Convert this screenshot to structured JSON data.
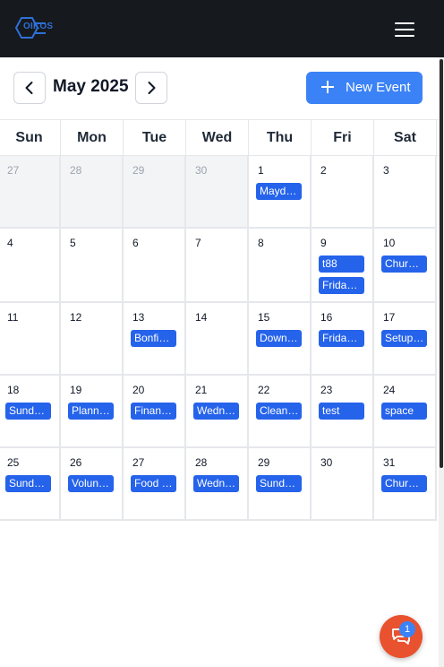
{
  "header": {
    "logo_text": "OIKOS",
    "logo_icon": "oikos-logo",
    "menu_icon": "hamburger-menu-icon"
  },
  "toolbar": {
    "month_title": "May 2025",
    "prev_icon": "chevron-left-icon",
    "next_icon": "chevron-right-icon",
    "new_event_label": "New Event"
  },
  "calendar": {
    "weekdays": [
      "Sun",
      "Mon",
      "Tue",
      "Wed",
      "Thu",
      "Fri",
      "Sat"
    ],
    "weeks": [
      [
        {
          "day": "27",
          "other": true,
          "events": []
        },
        {
          "day": "28",
          "other": true,
          "events": []
        },
        {
          "day": "29",
          "other": true,
          "events": []
        },
        {
          "day": "30",
          "other": true,
          "events": []
        },
        {
          "day": "1",
          "other": false,
          "events": [
            "Mayd…"
          ]
        },
        {
          "day": "2",
          "other": false,
          "events": []
        },
        {
          "day": "3",
          "other": false,
          "events": []
        }
      ],
      [
        {
          "day": "4",
          "other": false,
          "events": []
        },
        {
          "day": "5",
          "other": false,
          "events": []
        },
        {
          "day": "6",
          "other": false,
          "events": []
        },
        {
          "day": "7",
          "other": false,
          "events": []
        },
        {
          "day": "8",
          "other": false,
          "events": []
        },
        {
          "day": "9",
          "other": false,
          "events": [
            "t88",
            "Frida…"
          ]
        },
        {
          "day": "10",
          "other": false,
          "events": [
            "Chur…"
          ]
        }
      ],
      [
        {
          "day": "11",
          "other": false,
          "events": []
        },
        {
          "day": "12",
          "other": false,
          "events": []
        },
        {
          "day": "13",
          "other": false,
          "events": [
            "Bonfi…"
          ]
        },
        {
          "day": "14",
          "other": false,
          "events": []
        },
        {
          "day": "15",
          "other": false,
          "events": [
            "Down…"
          ]
        },
        {
          "day": "16",
          "other": false,
          "events": [
            "Frida…"
          ]
        },
        {
          "day": "17",
          "other": false,
          "events": [
            "Setup…"
          ]
        }
      ],
      [
        {
          "day": "18",
          "other": false,
          "events": [
            "Sund…"
          ]
        },
        {
          "day": "19",
          "other": false,
          "events": [
            "Plann…"
          ]
        },
        {
          "day": "20",
          "other": false,
          "events": [
            "Finan…"
          ]
        },
        {
          "day": "21",
          "other": false,
          "events": [
            "Wedn…"
          ]
        },
        {
          "day": "22",
          "other": false,
          "events": [
            "Clean…"
          ]
        },
        {
          "day": "23",
          "other": false,
          "events": [
            "test"
          ]
        },
        {
          "day": "24",
          "other": false,
          "events": [
            "space"
          ]
        }
      ],
      [
        {
          "day": "25",
          "other": false,
          "events": [
            "Sund…"
          ]
        },
        {
          "day": "26",
          "other": false,
          "events": [
            "Volun…"
          ]
        },
        {
          "day": "27",
          "other": false,
          "events": [
            "Food …"
          ]
        },
        {
          "day": "28",
          "other": false,
          "events": [
            "Wedn…"
          ]
        },
        {
          "day": "29",
          "other": false,
          "events": [
            "Sund…"
          ]
        },
        {
          "day": "30",
          "other": false,
          "events": []
        },
        {
          "day": "31",
          "other": false,
          "events": [
            "Chur…"
          ]
        }
      ]
    ]
  },
  "chat": {
    "icon": "chat-bubbles-icon",
    "badge_count": "1"
  },
  "colors": {
    "topbar": "#16191d",
    "accent": "#3b82f6",
    "event_chip": "#2563eb",
    "chat_button": "#e8522f"
  }
}
